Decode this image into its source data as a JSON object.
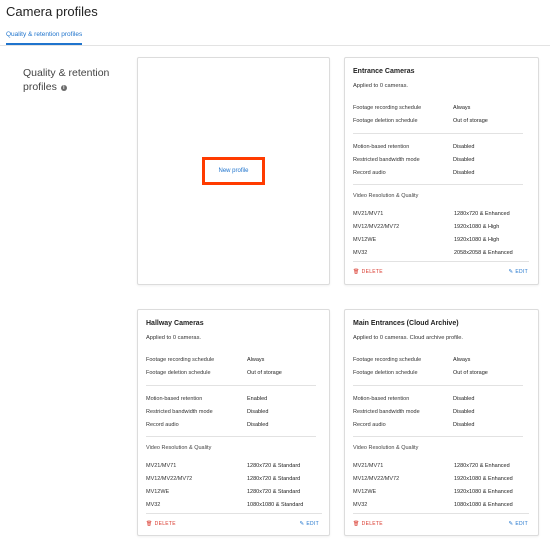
{
  "page": {
    "title": "Camera profiles",
    "tab": "Quality & retention profiles",
    "section_title": "Quality & retention profiles",
    "info_icon": "i"
  },
  "new_profile_label": "New profile",
  "icons": {
    "delete": "trash-icon",
    "edit": "pencil-icon",
    "info": "info-icon"
  },
  "colors": {
    "accent": "#1f74cd",
    "danger": "#d9372b",
    "highlight": "#ff3b00"
  },
  "labels": {
    "recording": "Footage recording schedule",
    "deletion": "Footage deletion schedule",
    "motion": "Motion-based retention",
    "bandwidth": "Restricted bandwidth mode",
    "audio": "Record audio",
    "video": "Video Resolution & Quality",
    "delete": "DELETE",
    "edit": "EDIT"
  },
  "cards": [
    {
      "title": "Entrance Cameras",
      "applied": "Applied to 0 cameras.",
      "recording": "Always",
      "deletion": "Out of storage",
      "motion": "Disabled",
      "bandwidth": "Disabled",
      "audio": "Disabled",
      "video": [
        {
          "model": "MV21/MV71",
          "value": "1280x720 & Enhanced"
        },
        {
          "model": "MV12/MV22/MV72",
          "value": "1920x1080 & High"
        },
        {
          "model": "MV12WE",
          "value": "1920x1080 & High"
        },
        {
          "model": "MV32",
          "value": "2058x2058 & Enhanced"
        }
      ]
    },
    {
      "title": "Hallway Cameras",
      "applied": "Applied to 0 cameras.",
      "recording": "Always",
      "deletion": "Out of storage",
      "motion": "Enabled",
      "bandwidth": "Disabled",
      "audio": "Disabled",
      "video": [
        {
          "model": "MV21/MV71",
          "value": "1280x720 & Standard"
        },
        {
          "model": "MV12/MV22/MV72",
          "value": "1280x720 & Standard"
        },
        {
          "model": "MV12WE",
          "value": "1280x720 & Standard"
        },
        {
          "model": "MV32",
          "value": "1080x1080 & Standard"
        }
      ]
    },
    {
      "title": "Main Entrances (Cloud Archive)",
      "applied": "Applied to 0 cameras. Cloud archive profile.",
      "recording": "Always",
      "deletion": "Out of storage",
      "motion": "Disabled",
      "bandwidth": "Disabled",
      "audio": "Disabled",
      "video": [
        {
          "model": "MV21/MV71",
          "value": "1280x720 & Enhanced"
        },
        {
          "model": "MV12/MV22/MV72",
          "value": "1920x1080 & Enhanced"
        },
        {
          "model": "MV12WE",
          "value": "1920x1080 & Enhanced"
        },
        {
          "model": "MV32",
          "value": "1080x1080 & Enhanced"
        }
      ]
    }
  ]
}
